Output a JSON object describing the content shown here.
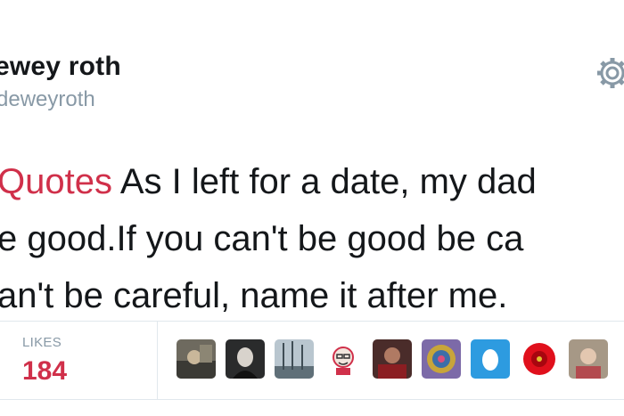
{
  "header": {
    "display_name": "ewey roth",
    "handle": "deweyroth"
  },
  "tweet": {
    "hashtag": "Quotes",
    "line1_rest": " As I left for a date, my dad",
    "line2": "e good.If you can't be good be ca",
    "line3": "an't be careful, name it after me."
  },
  "stats": {
    "likes_label": "LIKES",
    "likes_count": "184"
  },
  "icons": {
    "settings": "gear-icon"
  },
  "colors": {
    "accent": "#d0304a",
    "text": "#14171a",
    "muted": "#8899a6",
    "divider": "#e1e8ed"
  },
  "likers": [
    {
      "name": "avatar-1"
    },
    {
      "name": "avatar-2"
    },
    {
      "name": "avatar-3"
    },
    {
      "name": "avatar-4"
    },
    {
      "name": "avatar-5"
    },
    {
      "name": "avatar-6"
    },
    {
      "name": "avatar-7"
    },
    {
      "name": "avatar-8"
    },
    {
      "name": "avatar-9"
    }
  ]
}
